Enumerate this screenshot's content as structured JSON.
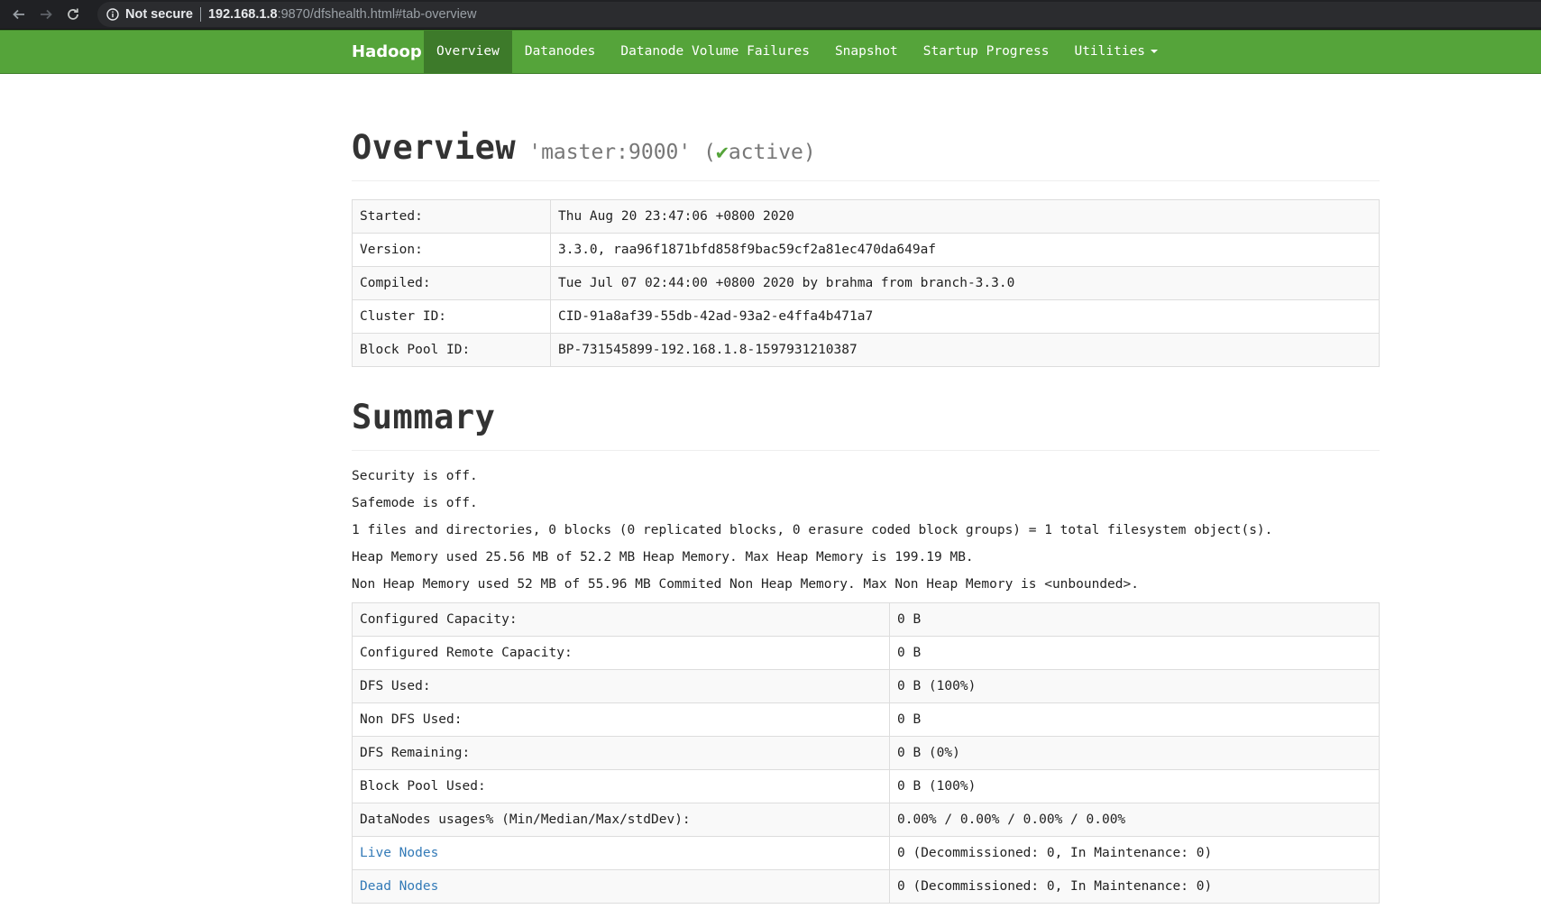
{
  "browser": {
    "security_label": "Not secure",
    "url_host": "192.168.1.8",
    "url_path": ":9870/dfshealth.html#tab-overview"
  },
  "navbar": {
    "brand": "Hadoop",
    "items": [
      {
        "label": "Overview",
        "active": true
      },
      {
        "label": "Datanodes"
      },
      {
        "label": "Datanode Volume Failures"
      },
      {
        "label": "Snapshot"
      },
      {
        "label": "Startup Progress"
      },
      {
        "label": "Utilities"
      }
    ]
  },
  "overview": {
    "title": "Overview",
    "host": "'master:9000'",
    "status_open": "(",
    "check": "✔",
    "status": "active)",
    "rows": [
      {
        "label": "Started:",
        "value": "Thu Aug 20 23:47:06 +0800 2020"
      },
      {
        "label": "Version:",
        "value": "3.3.0, raa96f1871bfd858f9bac59cf2a81ec470da649af"
      },
      {
        "label": "Compiled:",
        "value": "Tue Jul 07 02:44:00 +0800 2020 by brahma from branch-3.3.0"
      },
      {
        "label": "Cluster ID:",
        "value": "CID-91a8af39-55db-42ad-93a2-e4ffa4b471a7"
      },
      {
        "label": "Block Pool ID:",
        "value": "BP-731545899-192.168.1.8-1597931210387"
      }
    ]
  },
  "summary": {
    "title": "Summary",
    "lines": [
      "Security is off.",
      "Safemode is off.",
      "1 files and directories, 0 blocks (0 replicated blocks, 0 erasure coded block groups) = 1 total filesystem object(s).",
      "Heap Memory used 25.56 MB of 52.2 MB Heap Memory. Max Heap Memory is 199.19 MB.",
      "Non Heap Memory used 52 MB of 55.96 MB Commited Non Heap Memory. Max Non Heap Memory is <unbounded>."
    ],
    "rows": [
      {
        "label": "Configured Capacity:",
        "value": "0 B"
      },
      {
        "label": "Configured Remote Capacity:",
        "value": "0 B"
      },
      {
        "label": "DFS Used:",
        "value": "0 B (100%)"
      },
      {
        "label": "Non DFS Used:",
        "value": "0 B"
      },
      {
        "label": "DFS Remaining:",
        "value": "0 B (0%)"
      },
      {
        "label": "Block Pool Used:",
        "value": "0 B (100%)"
      },
      {
        "label": "DataNodes usages% (Min/Median/Max/stdDev):",
        "value": "0.00% / 0.00% / 0.00% / 0.00%"
      },
      {
        "label": "Live Nodes",
        "value": "0 (Decommissioned: 0, In Maintenance: 0)"
      },
      {
        "label": "Dead Nodes",
        "value": "0 (Decommissioned: 0, In Maintenance: 0)"
      }
    ]
  },
  "colors": {
    "navbar": "#55a43a",
    "active_tab": "#3d7a2a",
    "link": "#337ab7"
  }
}
